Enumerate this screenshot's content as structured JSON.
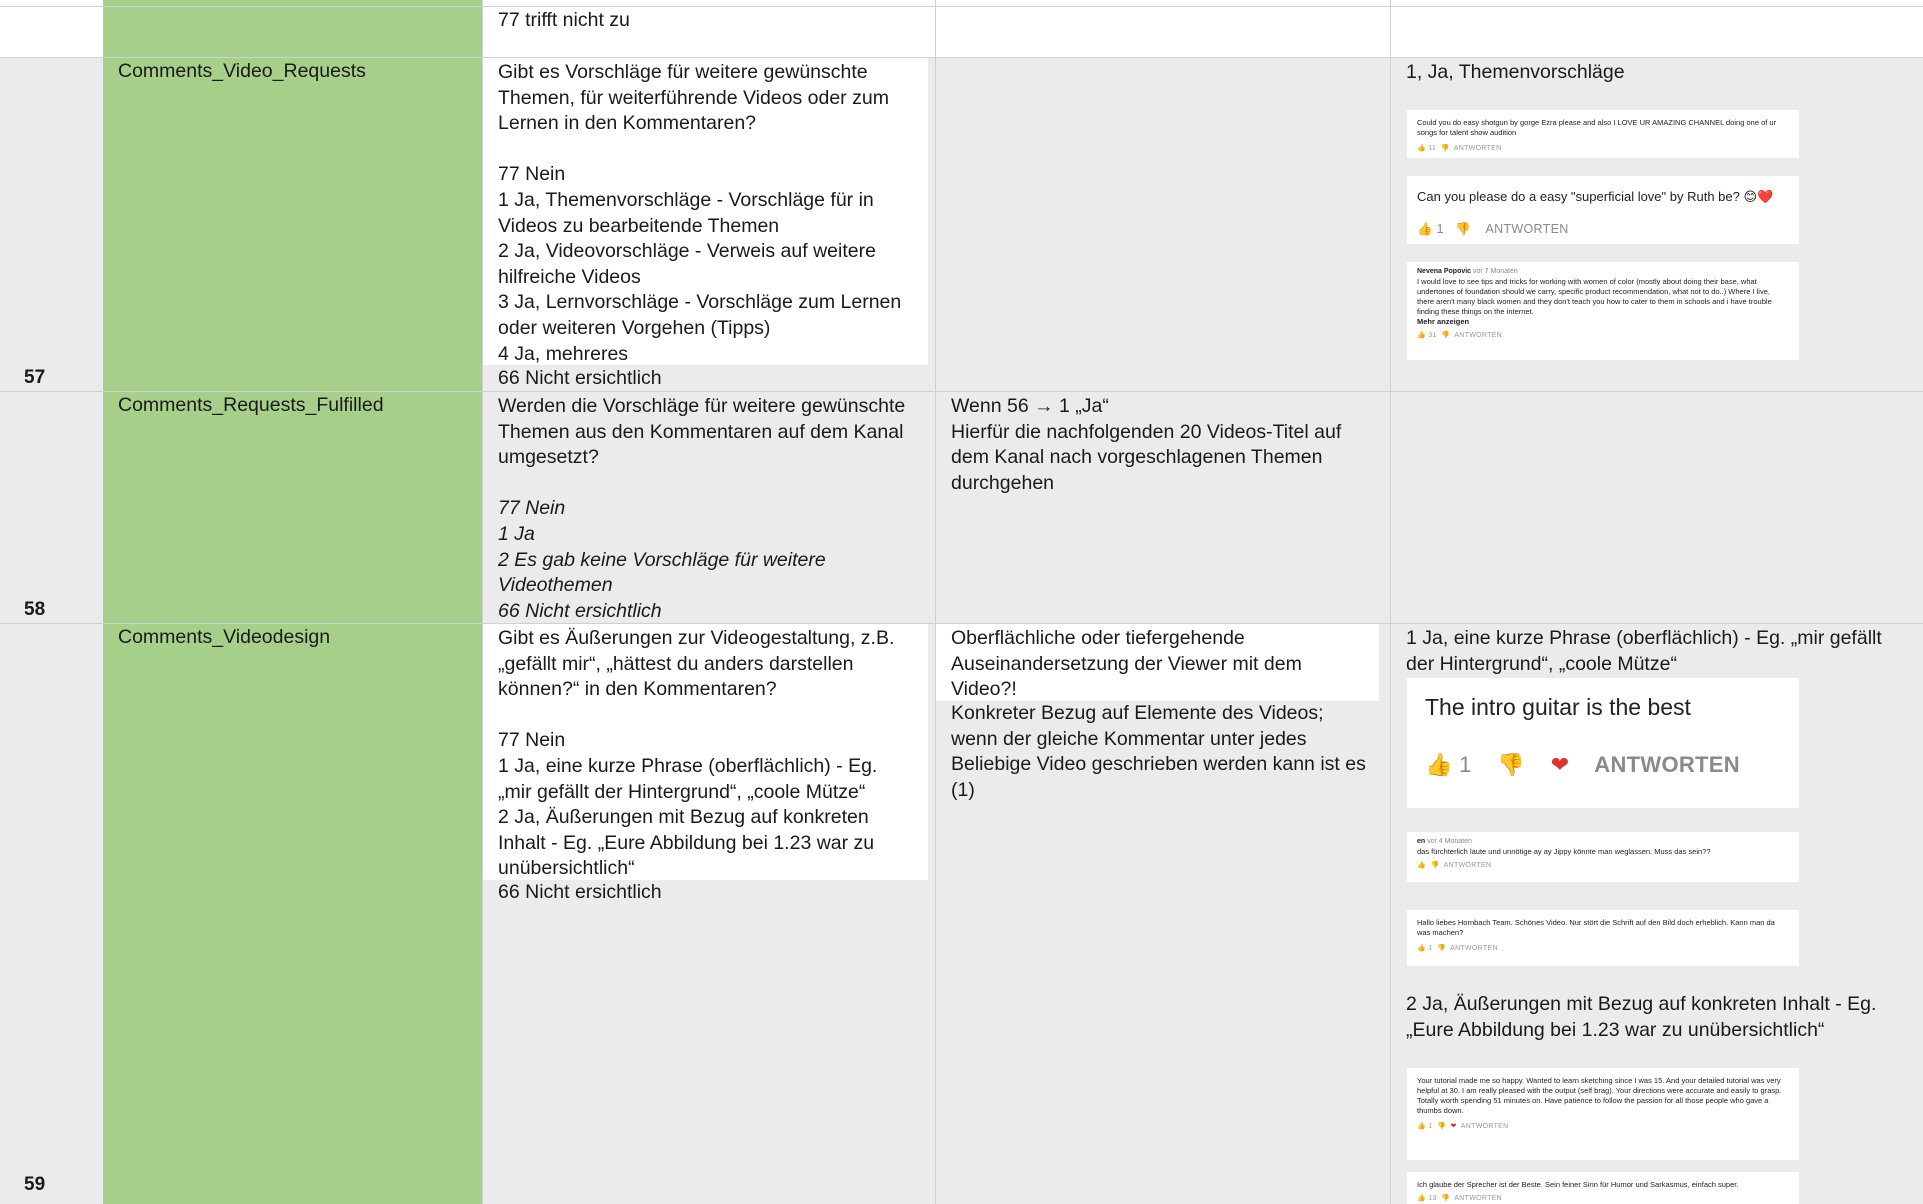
{
  "rows": {
    "top": {
      "coding": "77 trifft nicht zu"
    },
    "r57": {
      "number": "57",
      "variable": "Comments_Video_Requests",
      "question": "Gibt es Vorschläge für weitere gewünschte Themen, für weiterführende Videos oder zum Lernen in den Kommentaren?",
      "codes": [
        "77 Nein",
        "1 Ja, Themenvorschläge - Vorschläge für in Videos zu bearbeitende Themen",
        "2 Ja, Videovorschläge - Verweis auf weitere hilfreiche Videos",
        "3 Ja, Lernvorschläge - Vorschläge zum Lernen oder weiteren Vorgehen (Tipps)",
        "4 Ja, mehreres"
      ],
      "code_outside": "66 Nicht ersichtlich",
      "example_header": "1, Ja, Themenvorschläge",
      "examples": [
        {
          "text": "Could you do easy shotgun by gorge Ezra please and also I LOVE UR AMAZING CHANNEL doing one of ur songs for talent show audition",
          "likes": "11",
          "reply": "ANTWORTEN"
        },
        {
          "text": "Can you please do a easy \"superficial love\" by Ruth be? 😊❤️",
          "likes": "1",
          "reply": "ANTWORTEN"
        },
        {
          "author": "Nevena Popovic",
          "date": "vor 7 Monaten",
          "text": "I would love to see tips and tricks for working with women of color (mostly about doing their base, what undertones of foundation should we carry, specific product recommendation, what not to do..) Where I live, there aren't many black women and they don't teach you how to cater to them in schools and i have trouble finding these things on the internet.",
          "more": "Mehr anzeigen",
          "likes": "31",
          "reply": "ANTWORTEN"
        }
      ]
    },
    "r58": {
      "number": "58",
      "variable": "Comments_Requests_Fulfilled",
      "question": "Werden die Vorschläge für weitere gewünschte Themen aus den Kommentaren auf dem Kanal umgesetzt?",
      "codes": [
        "77 Nein",
        "1 Ja",
        "2 Es gab keine Vorschläge für weitere Videothemen",
        "66 Nicht ersichtlich"
      ],
      "note": "Wenn 56 → 1 „Ja“\nHierfür die nachfolgenden 20 Videos-Titel auf dem Kanal nach vorgeschlagenen Themen durchgehen"
    },
    "r59": {
      "number": "59",
      "variable": "Comments_Videodesign",
      "question": "Gibt es Äußerungen zur Videogestaltung, z.B. „gefällt mir“, „hättest du anders darstellen können?“ in den Kommentaren?",
      "codes": [
        "77 Nein",
        "1 Ja, eine kurze Phrase (oberflächlich) - Eg. „mir gefällt der Hintergrund“, „coole Mütze“",
        "2 Ja, Äußerungen mit Bezug auf konkreten Inhalt - Eg. „Eure Abbildung bei 1.23 war zu unübersichtlich“"
      ],
      "code_outside": "66 Nicht ersichtlich",
      "note_box": "Oberflächliche oder tiefergehende Auseinandersetzung der Viewer mit dem Video?!",
      "note_plain": "Konkreter Bezug auf Elemente des Videos; wenn der gleiche Kommentar unter jedes Beliebige Video geschrieben werden kann ist es (1)",
      "example_header_1": "1 Ja, eine kurze Phrase (oberflächlich) - Eg. „mir gefällt der Hintergrund“, „coole Mütze“",
      "examples_1": [
        {
          "text": "The intro guitar is the best",
          "likes": "1",
          "reply": "ANTWORTEN"
        },
        {
          "author": "en",
          "date": "vor 4 Monaten",
          "text": "das fürchterlich laute und unnötige ay ay Jippy könnte man weglassen. Muss das sein??",
          "likes": "",
          "reply": "ANTWORTEN"
        },
        {
          "text": "Hallo liebes Hornbach Team. Schönes Video. Nur stört die Schrift auf den Bild doch erheblich. Kann man da was machen?",
          "likes": "1",
          "reply": "ANTWORTEN"
        }
      ],
      "example_header_2": "2 Ja, Äußerungen mit Bezug auf konkreten Inhalt - Eg. „Eure Abbildung bei 1.23 war zu unübersichtlich“",
      "examples_2": [
        {
          "text": "Your tutorial made me so happy. Wanted to learn sketching since I was 15. And your detailed tutorial was very helpful at 30. I am really pleased with the output (self brag). Your directions were accurate and easily to grasp. Totally worth spending 51 minutes on. Have patience to follow the passion for all those people who gave a thumbs down.",
          "likes": "1",
          "reply": "ANTWORTEN"
        },
        {
          "text": "Ich glaube der Sprecher ist der Beste. Sein feiner Sinn für Humor und Sarkasmus, einfach super.",
          "likes": "13",
          "reply": "ANTWORTEN"
        }
      ]
    }
  },
  "icons": {
    "like": "thumbs-up-icon",
    "dislike": "thumbs-down-icon",
    "heart": "heart-icon"
  },
  "colors": {
    "variable_column": "#a6d08a",
    "row_bg": "#ebebeb"
  }
}
